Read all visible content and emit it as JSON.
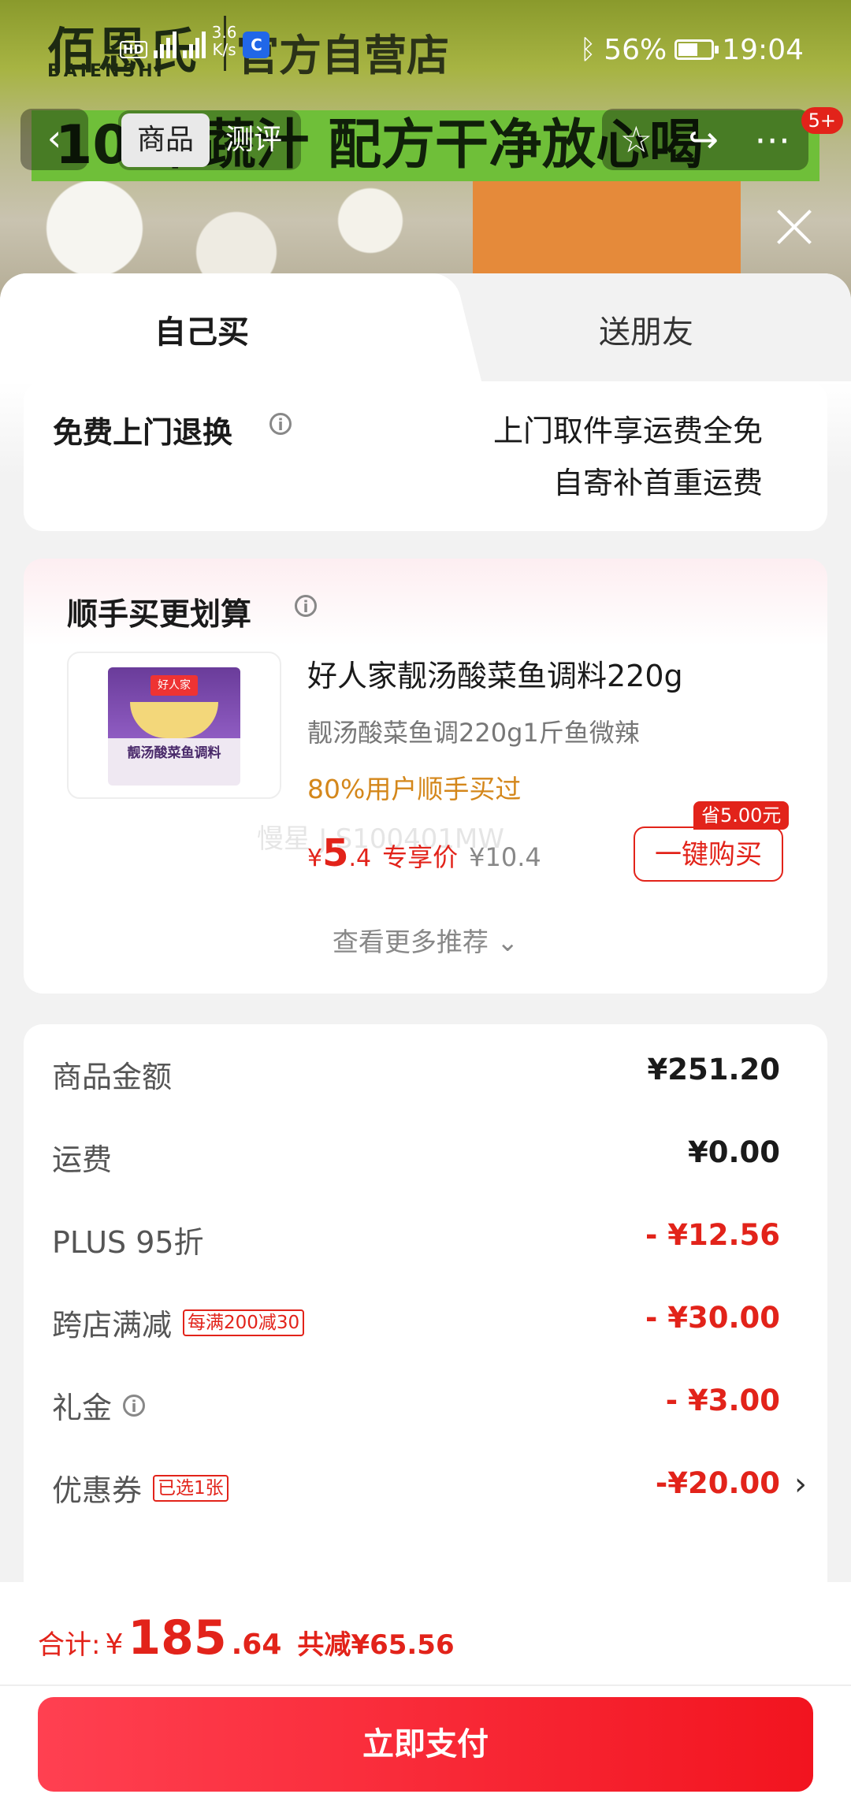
{
  "backdrop": {
    "brand": "佰恩氏",
    "brand_en": "BAIENSHI",
    "store": "官方自营店",
    "banner": "10 果蔬汁 配方干净放心喝"
  },
  "status_bar": {
    "speed": "3.6\nK/s",
    "battery": "56%",
    "time": "19:04"
  },
  "nav": {
    "tabs": [
      "商品",
      "测评"
    ],
    "badge": "5+"
  },
  "tabs": {
    "self": "自己买",
    "gift": "送朋友"
  },
  "returns": {
    "title": "免费上门退换",
    "line1": "上门取件享运费全免",
    "line2": "自寄补首重运费"
  },
  "combo": {
    "title": "顺手买更划算",
    "product_name": "好人家靓汤酸菜鱼调料220g",
    "product_sub": "靓汤酸菜鱼调220g1斤鱼微辣",
    "popularity": "80%用户顺手买过",
    "price_yen": "¥",
    "price_int": "5",
    "price_dec": ".4",
    "price_tag": "专享价",
    "price_orig": "¥10.4",
    "watermark": "慢星 J.S100401MW",
    "save_badge": "省5.00元",
    "buy_button": "一键购买",
    "more": "查看更多推荐 ⌄",
    "pkg_logo": "好人家",
    "pkg_name": "靓汤酸菜鱼调料"
  },
  "fees": [
    {
      "label": "商品金额",
      "value": "¥251.20"
    },
    {
      "label": "运费",
      "value": "¥0.00"
    },
    {
      "label": "PLUS 95折",
      "value": "- ¥12.56"
    },
    {
      "label": "跨店满减",
      "chip": "每满200减30",
      "value": "- ¥30.00"
    },
    {
      "label": "礼金",
      "value": "- ¥3.00"
    },
    {
      "label": "优惠券",
      "chip": "已选1张",
      "value": "-¥20.00"
    }
  ],
  "total": {
    "label": "合计:",
    "yen": "¥",
    "int": "185",
    "dec": ".64",
    "saved": "共减¥65.56"
  },
  "pay_button": "立即支付",
  "colors": {
    "accent": "#e2231a",
    "orange": "#d4871b",
    "pay_start": "#ff4051",
    "pay_end": "#f2141f"
  }
}
